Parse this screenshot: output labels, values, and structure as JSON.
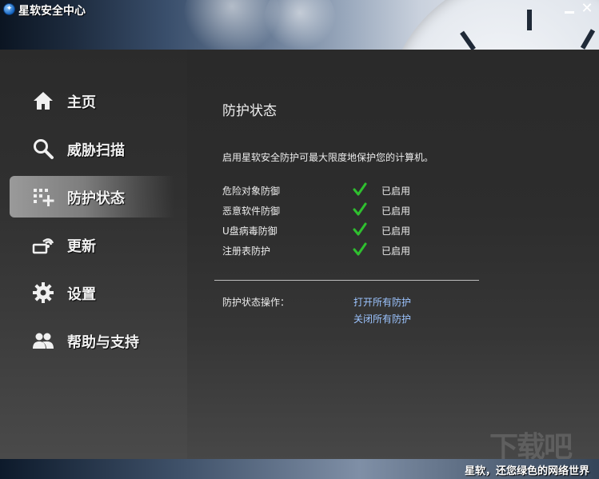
{
  "window": {
    "title": "星软安全中心",
    "logo_glyph": "✦",
    "minimize_glyph": "",
    "close_glyph": "✕"
  },
  "sidebar": {
    "items": [
      {
        "label": "主页",
        "icon": "home-icon",
        "active": false
      },
      {
        "label": "威胁扫描",
        "icon": "search-icon",
        "active": false
      },
      {
        "label": "防护状态",
        "icon": "shield-grid-icon",
        "active": true
      },
      {
        "label": "更新",
        "icon": "update-satellite-icon",
        "active": false
      },
      {
        "label": "设置",
        "icon": "gear-icon",
        "active": false
      },
      {
        "label": "帮助与支持",
        "icon": "users-icon",
        "active": false
      }
    ]
  },
  "main": {
    "title": "防护状态",
    "description": "启用星软安全防护可最大限度地保护您的计算机。",
    "statuses": [
      {
        "name": "危险对象防御",
        "value": "已启用"
      },
      {
        "name": "恶意软件防御",
        "value": "已启用"
      },
      {
        "name": "U盘病毒防御",
        "value": "已启用"
      },
      {
        "name": "注册表防护",
        "value": "已启用"
      }
    ],
    "operations_label": "防护状态操作：",
    "actions": [
      "打开所有防护",
      "关闭所有防护"
    ]
  },
  "colors": {
    "check_green": "#2fbf2f",
    "link_blue": "#9cc4ff",
    "active_item": "#8a8a8a"
  },
  "watermark": "下载吧",
  "footer": {
    "slogan": "星软，还您绿色的网络世界"
  }
}
